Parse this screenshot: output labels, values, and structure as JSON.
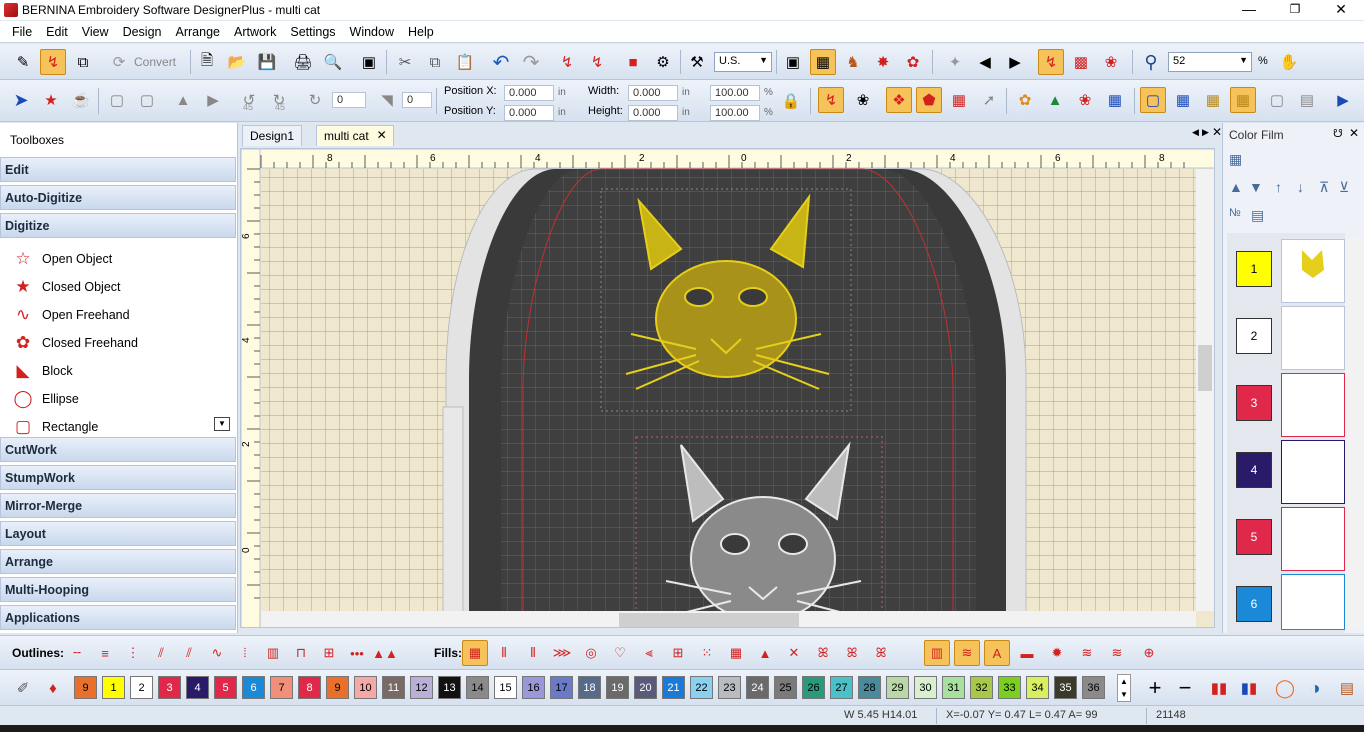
{
  "window": {
    "title": "BERNINA Embroidery Software DesignerPlus - multi cat"
  },
  "menu": [
    "File",
    "Edit",
    "View",
    "Design",
    "Arrange",
    "Artwork",
    "Settings",
    "Window",
    "Help"
  ],
  "toolbar1": {
    "convert_label": "Convert",
    "units_value": "U.S.",
    "zoom_value": "52",
    "zoom_unit": "%"
  },
  "toolbar2": {
    "rotate_value": "0",
    "slant_value": "0",
    "posx_label": "Position X:",
    "posx_value": "0.000",
    "posy_label": "Position Y:",
    "posy_value": "0.000",
    "width_label": "Width:",
    "width_value": "0.000",
    "height_label": "Height:",
    "height_value": "0.000",
    "pct_w": "100.00",
    "pct_h": "100.00",
    "unit_in": "in",
    "unit_pct": "%",
    "rot_45a": "45",
    "rot_45b": "45"
  },
  "toolboxes": {
    "title": "Toolboxes",
    "sections_top": [
      "Edit",
      "Auto-Digitize",
      "Digitize"
    ],
    "digitize_items": [
      "Open Object",
      "Closed Object",
      "Open Freehand",
      "Closed Freehand",
      "Block",
      "Ellipse",
      "Rectangle"
    ],
    "sections_bottom": [
      "CutWork",
      "StumpWork",
      "Mirror-Merge",
      "Layout",
      "Arrange",
      "Multi-Hooping",
      "Applications"
    ]
  },
  "doc_tabs": [
    "Design1",
    "multi cat"
  ],
  "ruler": {
    "h_labels": [
      "8",
      "6",
      "4",
      "2",
      "0",
      "2",
      "4",
      "6",
      "8"
    ],
    "v_labels": [
      "6",
      "4",
      "2",
      "0"
    ]
  },
  "color_film": {
    "title": "Color Film",
    "items": [
      {
        "num": "1",
        "color": "#ffff00"
      },
      {
        "num": "2",
        "color": "#ffffff"
      },
      {
        "num": "3",
        "color": "#e0294a"
      },
      {
        "num": "4",
        "color": "#2a1a6a"
      },
      {
        "num": "5",
        "color": "#e0294a"
      },
      {
        "num": "6",
        "color": "#1a8ad8"
      }
    ]
  },
  "bottom_toolbar": {
    "outlines_label": "Outlines:",
    "fills_label": "Fills:"
  },
  "palette": [
    {
      "n": "9",
      "c": "#e8702a"
    },
    {
      "n": "1",
      "c": "#ffff00"
    },
    {
      "n": "2",
      "c": "#ffffff"
    },
    {
      "n": "3",
      "c": "#e0294a"
    },
    {
      "n": "4",
      "c": "#2a1a6a"
    },
    {
      "n": "5",
      "c": "#e0294a"
    },
    {
      "n": "6",
      "c": "#1a8ad8"
    },
    {
      "n": "7",
      "c": "#f0907a"
    },
    {
      "n": "8",
      "c": "#e0294a"
    },
    {
      "n": "9",
      "c": "#e8702a"
    },
    {
      "n": "10",
      "c": "#f4a8a8"
    },
    {
      "n": "11",
      "c": "#7a6a66"
    },
    {
      "n": "12",
      "c": "#b8b0d6"
    },
    {
      "n": "13",
      "c": "#111111"
    },
    {
      "n": "14",
      "c": "#8a8a8a"
    },
    {
      "n": "15",
      "c": "#ffffff"
    },
    {
      "n": "16",
      "c": "#9a98d8"
    },
    {
      "n": "17",
      "c": "#6a7ac8"
    },
    {
      "n": "18",
      "c": "#566a8a"
    },
    {
      "n": "19",
      "c": "#6a6a6a"
    },
    {
      "n": "20",
      "c": "#5a5a7a"
    },
    {
      "n": "21",
      "c": "#1a7ad8"
    },
    {
      "n": "22",
      "c": "#8ad0f0"
    },
    {
      "n": "23",
      "c": "#b8bcc0"
    },
    {
      "n": "24",
      "c": "#6a6a6a"
    },
    {
      "n": "25",
      "c": "#7a7a7a"
    },
    {
      "n": "26",
      "c": "#2a9a7a"
    },
    {
      "n": "27",
      "c": "#4ac0c8"
    },
    {
      "n": "28",
      "c": "#4a8a9a"
    },
    {
      "n": "29",
      "c": "#b8d8a8"
    },
    {
      "n": "30",
      "c": "#d8f0d0"
    },
    {
      "n": "31",
      "c": "#a8e0a0"
    },
    {
      "n": "32",
      "c": "#a8c84a"
    },
    {
      "n": "33",
      "c": "#7ad020"
    },
    {
      "n": "34",
      "c": "#d8f060"
    },
    {
      "n": "35",
      "c": "#3a3a2a"
    },
    {
      "n": "36",
      "c": "#8a8a8a"
    }
  ],
  "status": {
    "size": "W 5.45 H14.01",
    "coords": "X=-0.07 Y= 0.47 L= 0.47 A=  99",
    "stitches": "21148"
  }
}
